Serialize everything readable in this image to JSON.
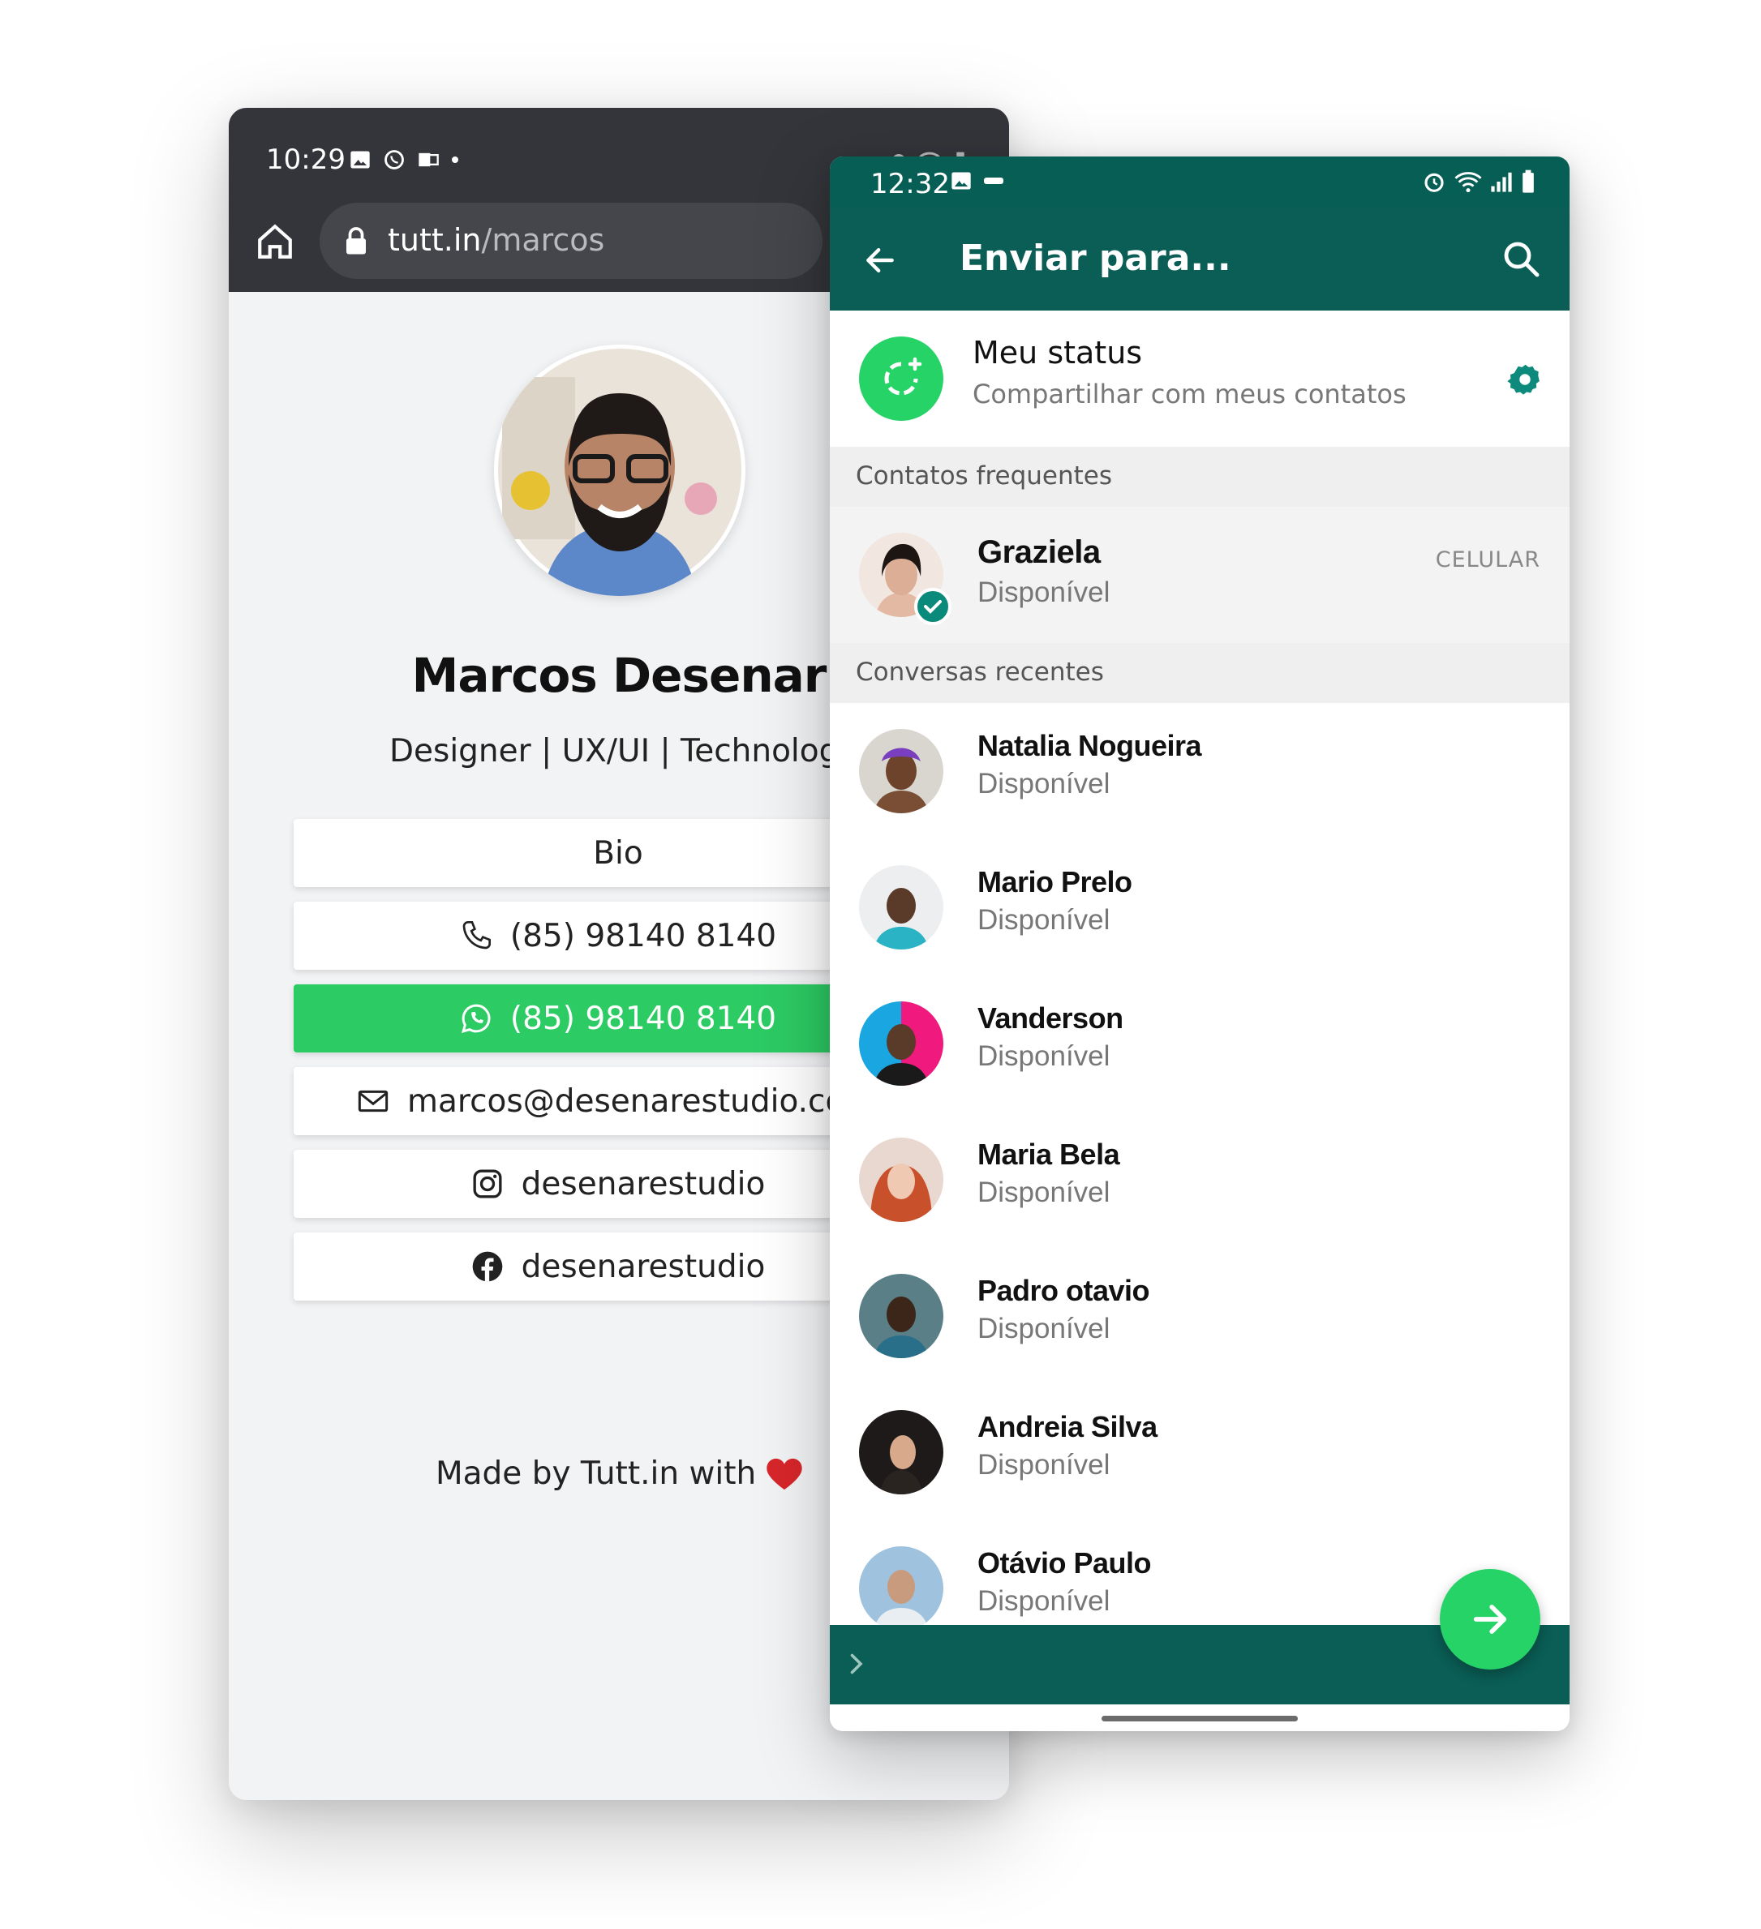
{
  "browser": {
    "status_time": "10:29",
    "url_host": "tutt.in",
    "url_path": "/marcos"
  },
  "profile": {
    "name": "Marcos Desenar",
    "subtitle": "Designer | UX/UI | Technology",
    "buttons": {
      "bio": "Bio",
      "phone": "(85) 98140 8140",
      "whatsapp": "(85) 98140 8140",
      "email": "marcos@desenarestudio.com",
      "instagram": "desenarestudio",
      "facebook": "desenarestudio"
    },
    "made_by": "Made by Tutt.in with"
  },
  "whatsapp": {
    "status_time": "12:32",
    "title": "Enviar para...",
    "my_status": {
      "title": "Meu status",
      "subtitle": "Compartilhar com meus contatos"
    },
    "section_frequent": "Contatos frequentes",
    "frequent": {
      "name": "Graziela",
      "status": "Disponível",
      "badge": "CELULAR"
    },
    "section_recent": "Conversas recentes",
    "recent": [
      {
        "name": "Natalia Nogueira",
        "status": "Disponível"
      },
      {
        "name": "Mario Prelo",
        "status": "Disponível"
      },
      {
        "name": "Vanderson",
        "status": "Disponível"
      },
      {
        "name": "Maria Bela",
        "status": "Disponível"
      },
      {
        "name": "Padro otavio",
        "status": "Disponível"
      },
      {
        "name": "Andreia Silva",
        "status": "Disponível"
      },
      {
        "name": "Otávio Paulo",
        "status": "Disponível"
      }
    ]
  },
  "colors": {
    "whatsapp_dark": "#075e54",
    "whatsapp_teal": "#0a5e55",
    "whatsapp_green": "#25d366",
    "link_green": "#2ccb64",
    "browser_dark": "#34353a"
  }
}
